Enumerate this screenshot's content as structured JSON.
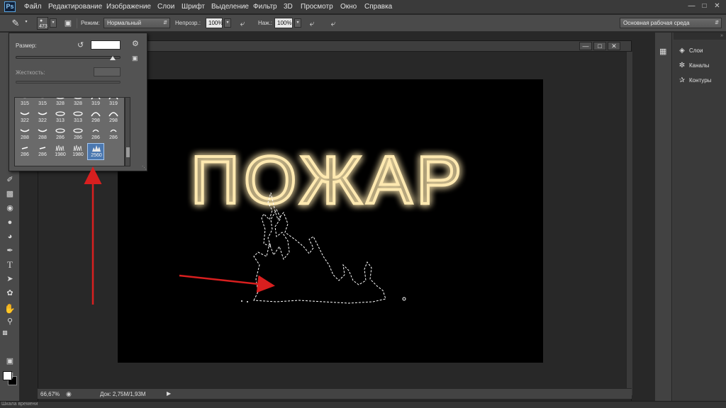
{
  "app": {
    "logo": "Ps",
    "menu": [
      "Файл",
      "Редактирование",
      "Изображение",
      "Слои",
      "Шрифт",
      "Выделение",
      "Фильтр",
      "3D",
      "Просмотр",
      "Окно",
      "Справка"
    ],
    "window_controls": [
      "minimize-icon",
      "maximize-icon",
      "close-icon"
    ]
  },
  "options_bar": {
    "brush_size": "473",
    "mode_label": "Режим:",
    "mode_value": "Нормальный",
    "opacity_label": "Непрозр.:",
    "opacity_value": "100%",
    "pressure_label": "Наж.:",
    "pressure_value": "100%",
    "workspace_value": "Основная рабочая среда"
  },
  "brush_picker": {
    "size_label": "Размер:",
    "hardness_label": "Жесткость:",
    "size_slider_fraction": 0.92,
    "hardness_slider_fraction": 0,
    "brushes": [
      {
        "num": "315",
        "shape": "wide-dash"
      },
      {
        "num": "315",
        "shape": "wide-dash"
      },
      {
        "num": "328",
        "shape": "eye"
      },
      {
        "num": "328",
        "shape": "eye"
      },
      {
        "num": "319",
        "shape": "arch"
      },
      {
        "num": "319",
        "shape": "arch"
      },
      {
        "num": "322",
        "shape": "wide-dash"
      },
      {
        "num": "322",
        "shape": "wide-dash"
      },
      {
        "num": "313",
        "shape": "eye"
      },
      {
        "num": "313",
        "shape": "eye"
      },
      {
        "num": "298",
        "shape": "arch"
      },
      {
        "num": "298",
        "shape": "arch"
      },
      {
        "num": "288",
        "shape": "wide-dash"
      },
      {
        "num": "288",
        "shape": "wide-dash"
      },
      {
        "num": "286",
        "shape": "eye"
      },
      {
        "num": "286",
        "shape": "eye"
      },
      {
        "num": "286",
        "shape": "small-curve"
      },
      {
        "num": "286",
        "shape": "small-curve"
      },
      {
        "num": "286",
        "shape": "dash"
      },
      {
        "num": "286",
        "shape": "dash"
      },
      {
        "num": "1980",
        "shape": "grass"
      },
      {
        "num": "1980",
        "shape": "grass"
      },
      {
        "num": "2560",
        "shape": "flame",
        "selected": true
      }
    ]
  },
  "document": {
    "tab_suffix": "*",
    "zoom": "66,67%",
    "doc_size": "Док: 2,75M/1,93M",
    "canvas_text": "ПОЖАР",
    "text_glow_color": "#ff9a1a",
    "text_core_color": "#ffe9b0"
  },
  "panels": {
    "items": [
      {
        "label": "Слои",
        "icon": "layers-icon"
      },
      {
        "label": "Каналы",
        "icon": "channels-icon"
      },
      {
        "label": "Контуры",
        "icon": "paths-icon"
      }
    ]
  },
  "timeline_label": "Шкала времени",
  "colors": {
    "foreground": "#ffffff",
    "background": "#000000",
    "annotation_arrow": "#d81f1f",
    "selected_brush": "#4b78b0"
  }
}
